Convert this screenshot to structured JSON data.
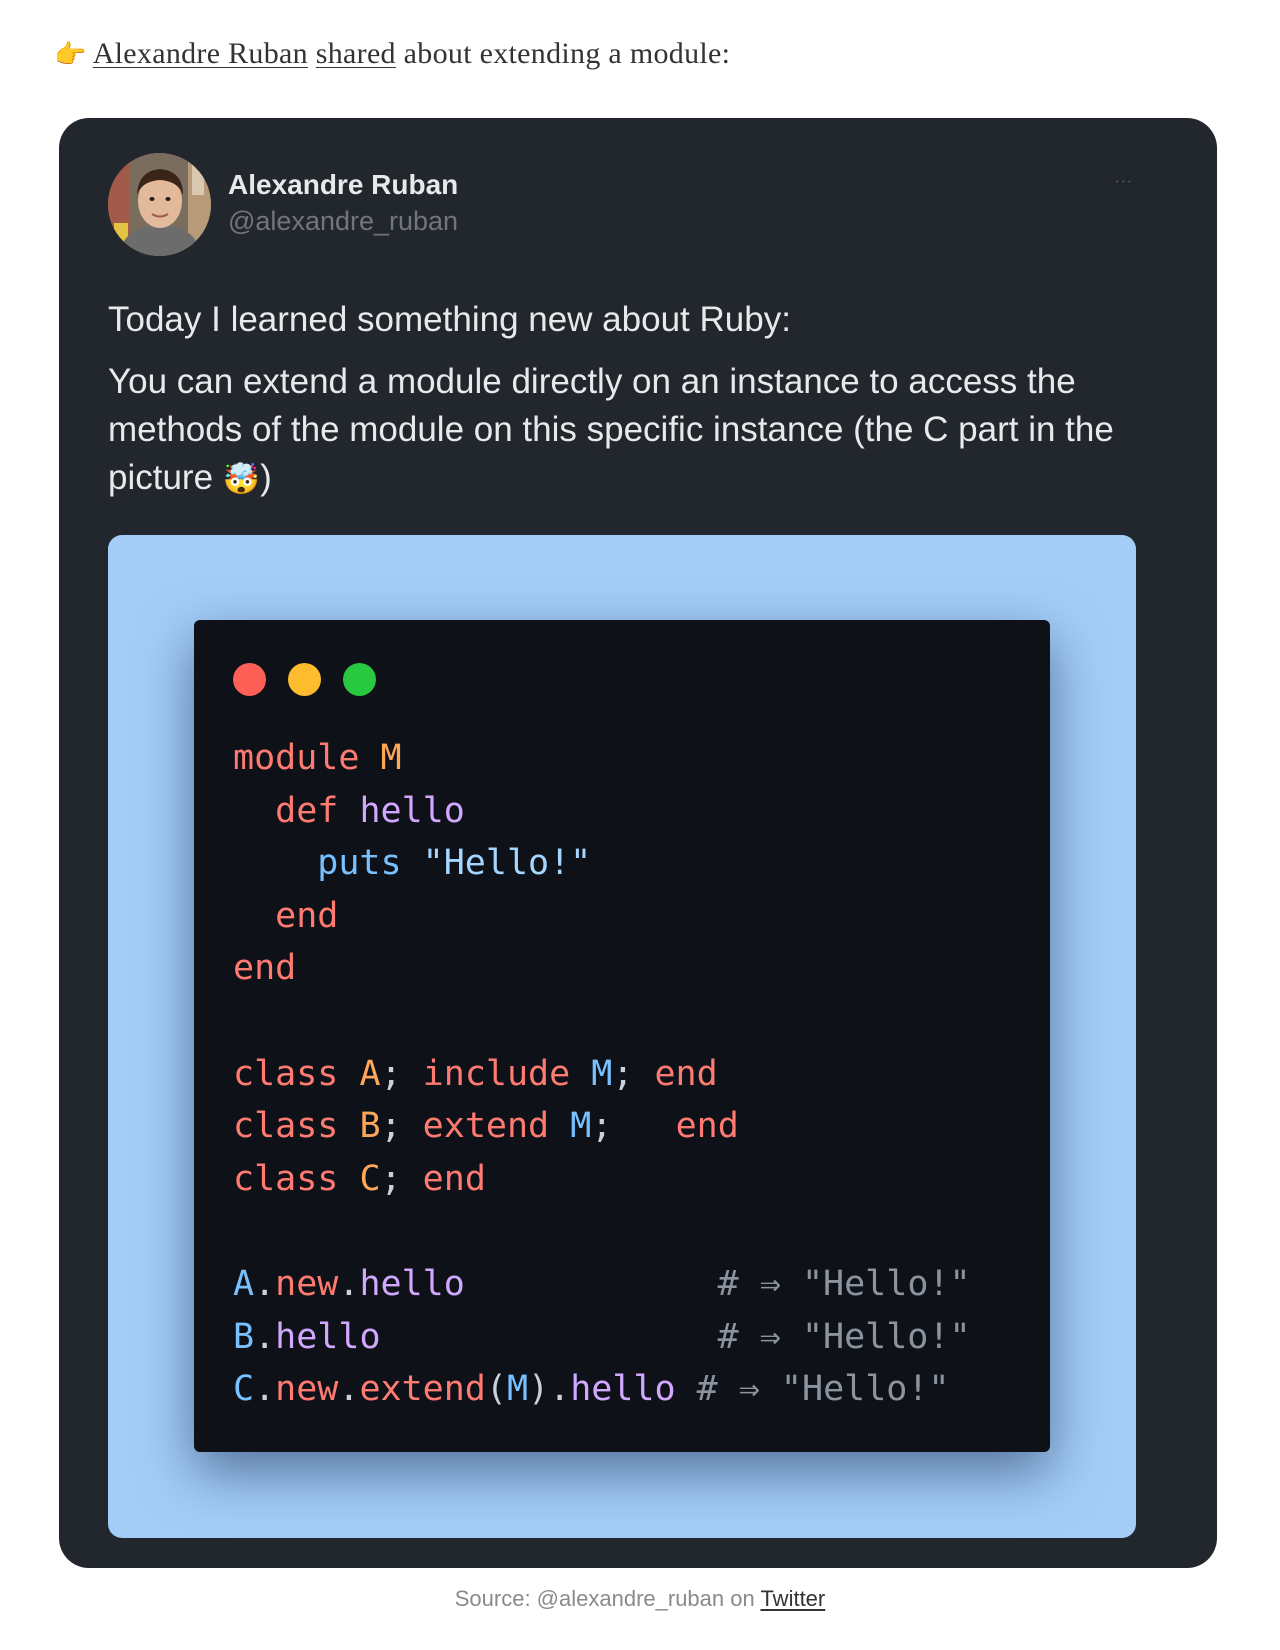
{
  "intro": {
    "pointer_icon": "backhand-index-pointing-right-icon",
    "pointer_glyph": "👉",
    "author_link": "Alexandre Ruban",
    "shared_link": "shared",
    "rest": " about extending a module:"
  },
  "tweet": {
    "author": {
      "name": "Alexandre Ruban",
      "handle": "@alexandre_ruban"
    },
    "more_glyph": "···",
    "text_line1": "Today I learned something new about Ruby:",
    "text_line2": "You can extend a module directly on an instance to access the methods of the module on this specific instance (the C part in the picture ",
    "emoji": "🤯",
    "text_line2_end": ")",
    "code": {
      "background": "#a3cdf7",
      "window_bg": "#0e1218",
      "lines": [
        [
          {
            "t": "module ",
            "c": "kw"
          },
          {
            "t": "M",
            "c": "const"
          }
        ],
        [
          {
            "t": "  def ",
            "c": "kw"
          },
          {
            "t": "hello",
            "c": "fn"
          }
        ],
        [
          {
            "t": "    puts ",
            "c": "mod"
          },
          {
            "t": "\"Hello!\"",
            "c": "str"
          }
        ],
        [
          {
            "t": "  end",
            "c": "kw"
          }
        ],
        [
          {
            "t": "end",
            "c": "kw"
          }
        ],
        [],
        [
          {
            "t": "class ",
            "c": "kw"
          },
          {
            "t": "A",
            "c": "const"
          },
          {
            "t": "; ",
            "c": "plain"
          },
          {
            "t": "include ",
            "c": "kw"
          },
          {
            "t": "M",
            "c": "mod"
          },
          {
            "t": "; ",
            "c": "plain"
          },
          {
            "t": "end",
            "c": "kw"
          }
        ],
        [
          {
            "t": "class ",
            "c": "kw"
          },
          {
            "t": "B",
            "c": "const"
          },
          {
            "t": "; ",
            "c": "plain"
          },
          {
            "t": "extend ",
            "c": "kw"
          },
          {
            "t": "M",
            "c": "mod"
          },
          {
            "t": ";   ",
            "c": "plain"
          },
          {
            "t": "end",
            "c": "kw"
          }
        ],
        [
          {
            "t": "class ",
            "c": "kw"
          },
          {
            "t": "C",
            "c": "const"
          },
          {
            "t": "; ",
            "c": "plain"
          },
          {
            "t": "end",
            "c": "kw"
          }
        ],
        [],
        [
          {
            "t": "A",
            "c": "mod"
          },
          {
            "t": ".",
            "c": "plain"
          },
          {
            "t": "new",
            "c": "kw"
          },
          {
            "t": ".",
            "c": "plain"
          },
          {
            "t": "hello",
            "c": "fn"
          },
          {
            "t": "            # ⇒ \"Hello!\"",
            "c": "comment"
          }
        ],
        [
          {
            "t": "B",
            "c": "mod"
          },
          {
            "t": ".",
            "c": "plain"
          },
          {
            "t": "hello",
            "c": "fn"
          },
          {
            "t": "                # ⇒ \"Hello!\"",
            "c": "comment"
          }
        ],
        [
          {
            "t": "C",
            "c": "mod"
          },
          {
            "t": ".",
            "c": "plain"
          },
          {
            "t": "new",
            "c": "kw"
          },
          {
            "t": ".",
            "c": "plain"
          },
          {
            "t": "extend",
            "c": "kw"
          },
          {
            "t": "(",
            "c": "plain"
          },
          {
            "t": "M",
            "c": "mod"
          },
          {
            "t": ").",
            "c": "plain"
          },
          {
            "t": "hello",
            "c": "fn"
          },
          {
            "t": " # ⇒ \"Hello!\"",
            "c": "comment"
          }
        ]
      ]
    }
  },
  "source": {
    "prefix": "Source: @alexandre_ruban on ",
    "link": "Twitter"
  }
}
